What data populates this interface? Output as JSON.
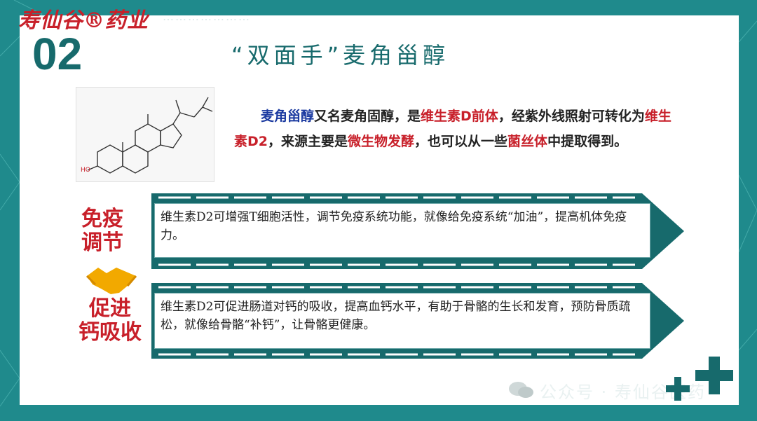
{
  "header": {
    "brand": "寿仙谷®药业",
    "brand_subtitle": "…………………",
    "section_number": "02",
    "title": "“双面手”麦角甾醇"
  },
  "description": {
    "parts": [
      {
        "t": "麦角甾醇",
        "c": "b"
      },
      {
        "t": "又名麦角固醇，是",
        "c": ""
      },
      {
        "t": "维生素D前体",
        "c": "r"
      },
      {
        "t": "，经紫外线照射可转化为",
        "c": ""
      },
      {
        "t": "维生素D2",
        "c": "r"
      },
      {
        "t": "，来源主要是",
        "c": ""
      },
      {
        "t": "微生物发酵",
        "c": "r"
      },
      {
        "t": "，也可以从一些",
        "c": ""
      },
      {
        "t": "菌丝体",
        "c": "r"
      },
      {
        "t": "中提取得到。",
        "c": ""
      }
    ]
  },
  "benefits": [
    {
      "label_line1": "免疫",
      "label_line2": "调节",
      "text": "维生素D2可增强T细胞活性，调节免疫系统功能，就像给免疫系统“加油”，提高机体免疫力。"
    },
    {
      "label_line1": "促进",
      "label_line2": "钙吸收",
      "text": "维生素D2可促进肠道对钙的吸收，提高血钙水平，有助于骨骼的生长和发育，预防骨质疏松，就像给骨骼“补钙”，让骨骼更健康。"
    }
  ],
  "watermark": "公众号 · 寿仙谷医药",
  "icons": {
    "handshake": "handshake-icon",
    "molecule": "ergosterol-structure",
    "wechat": "wechat-icon",
    "cross": "medical-cross-icon"
  },
  "colors": {
    "teal": "#176a6c",
    "red": "#c8202a",
    "blue": "#1b3aa0"
  }
}
